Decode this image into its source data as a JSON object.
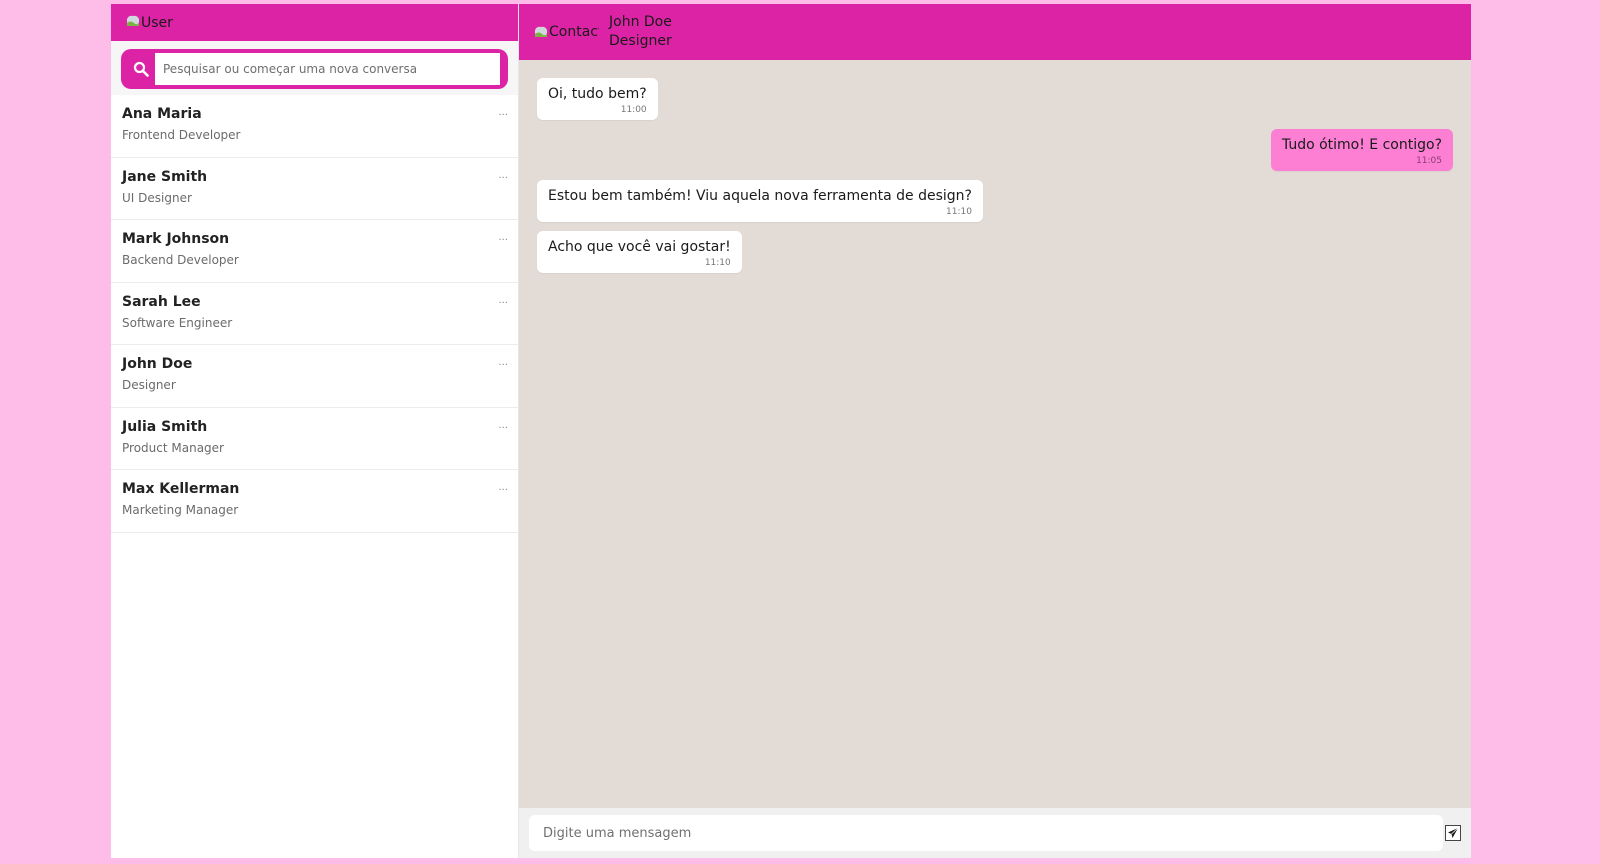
{
  "accent_color": "#dd23a5",
  "sent_bubble_color": "#fc7fd4",
  "chat_background": "#e3dcd6",
  "sidebar": {
    "user_avatar_alt": "User",
    "search": {
      "icon": "search-icon",
      "placeholder": "Pesquisar ou começar uma nova conversa"
    },
    "contacts": [
      {
        "name": "Ana Maria",
        "role": "Frontend Developer",
        "more": "..."
      },
      {
        "name": "Jane Smith",
        "role": "UI Designer",
        "more": "..."
      },
      {
        "name": "Mark Johnson",
        "role": "Backend Developer",
        "more": "..."
      },
      {
        "name": "Sarah Lee",
        "role": "Software Engineer",
        "more": "..."
      },
      {
        "name": "John Doe",
        "role": "Designer",
        "more": "..."
      },
      {
        "name": "Julia Smith",
        "role": "Product Manager",
        "more": "..."
      },
      {
        "name": "Max Kellerman",
        "role": "Marketing Manager",
        "more": "..."
      }
    ]
  },
  "chat": {
    "contact_avatar_alt": "Contact",
    "contact_name": "John Doe",
    "contact_role": "Designer",
    "messages": [
      {
        "text": "Oi, tudo bem?",
        "time": "11:00",
        "direction": "received"
      },
      {
        "text": "Tudo ótimo! E contigo?",
        "time": "11:05",
        "direction": "sent"
      },
      {
        "text": "Estou bem também! Viu aquela nova ferramenta de design?",
        "time": "11:10",
        "direction": "received"
      },
      {
        "text": "Acho que você vai gostar!",
        "time": "11:10",
        "direction": "received"
      }
    ],
    "composer": {
      "placeholder": "Digite uma mensagem",
      "send_icon": "send-icon"
    }
  }
}
